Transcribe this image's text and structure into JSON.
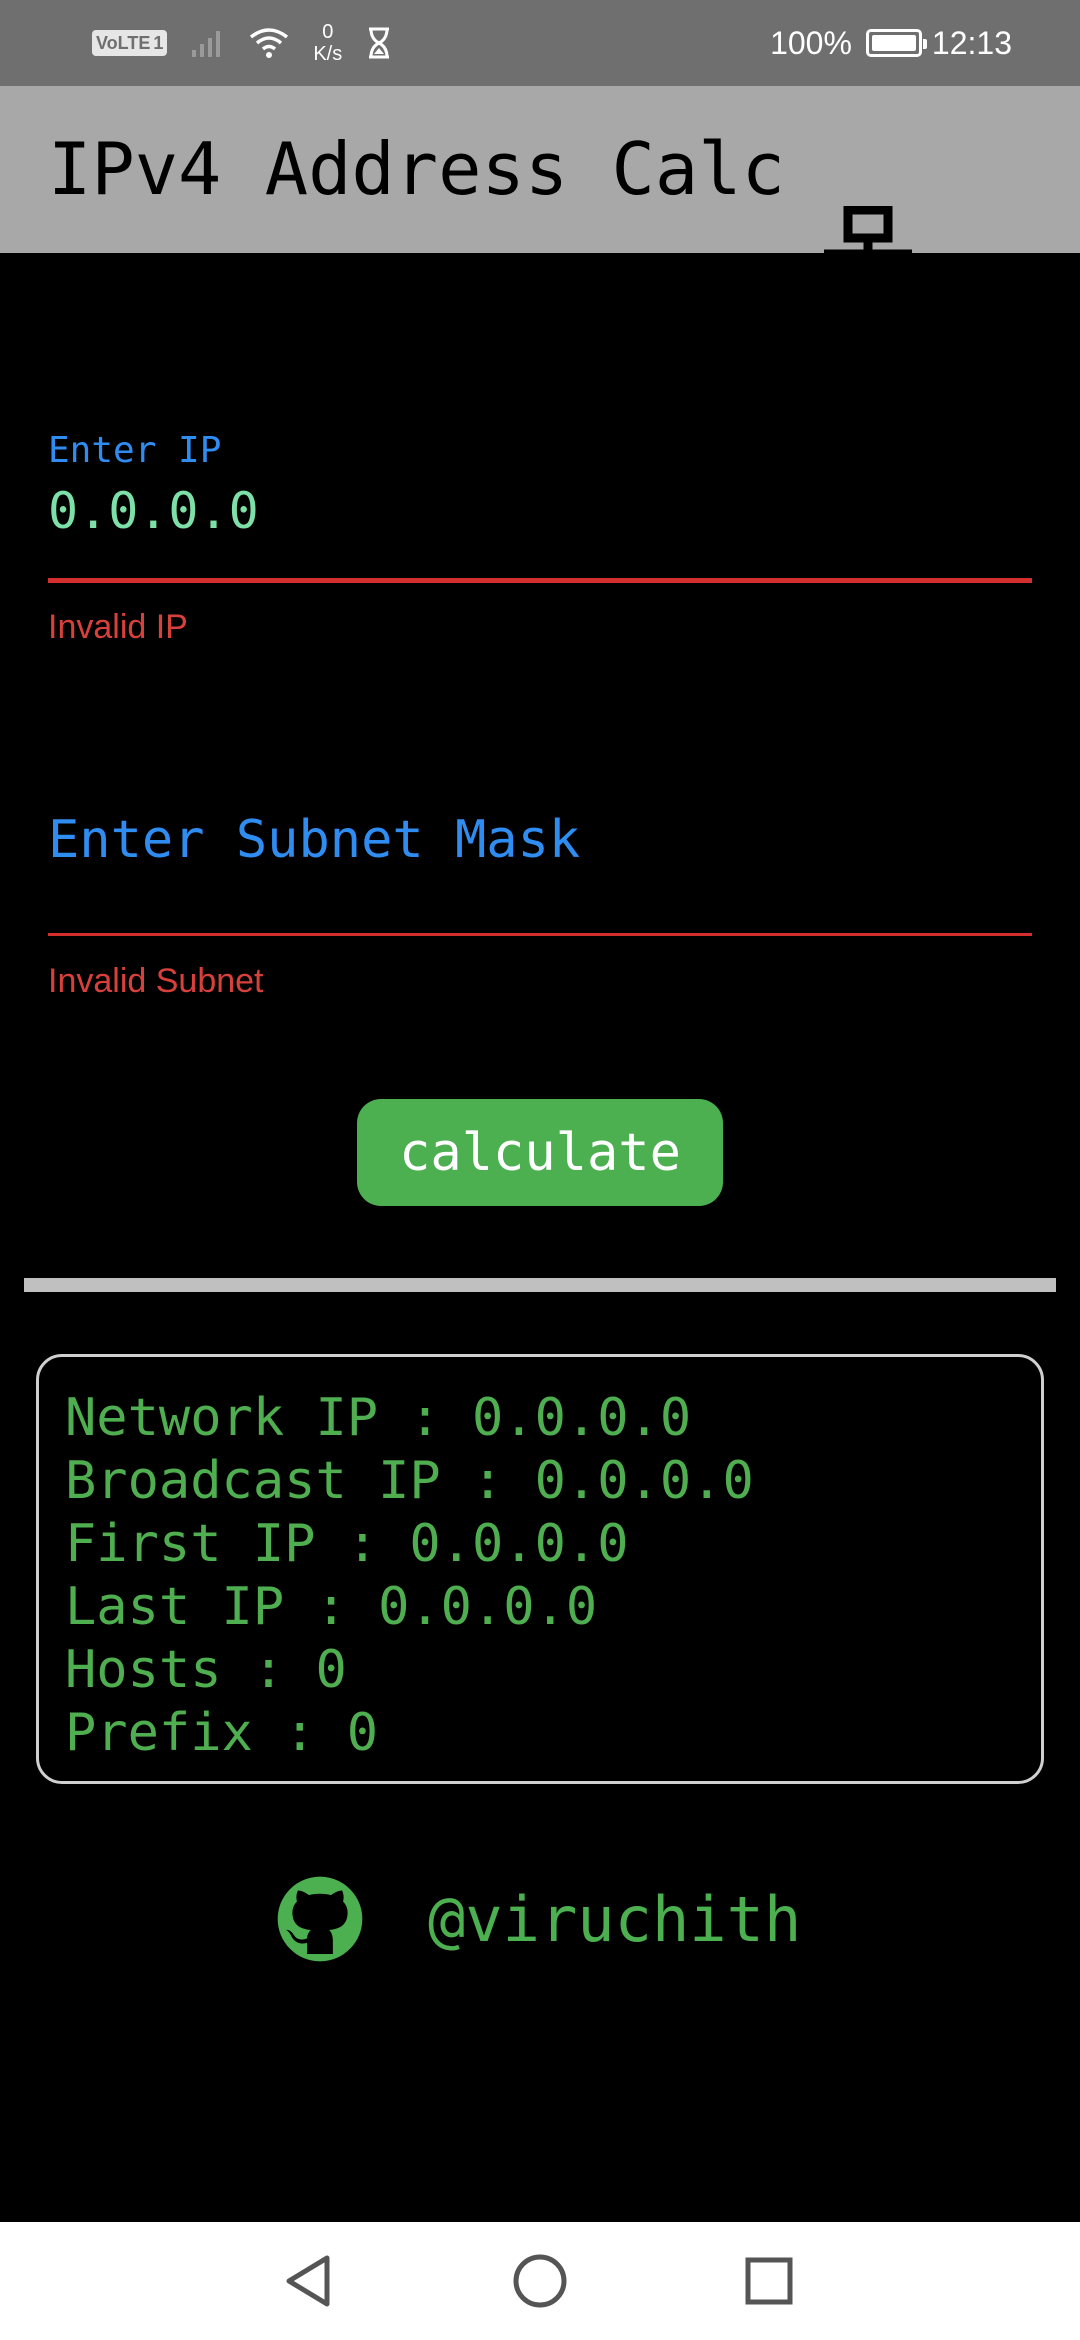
{
  "status_bar": {
    "volte_label": "VoLTE",
    "sim_slot": "1",
    "net_speed_value": "0",
    "net_speed_unit": "K/s",
    "battery_percent": "100%",
    "battery_level": 1.0,
    "time": "12:13"
  },
  "app_bar": {
    "title": "IPv4 Address Calc",
    "icon": "network-icon"
  },
  "ip_field": {
    "label": "Enter IP",
    "value": "0.0.0.0",
    "error": "Invalid IP"
  },
  "subnet_field": {
    "placeholder": "Enter Subnet Mask",
    "error": "Invalid Subnet"
  },
  "calculate_button": {
    "label": "calculate"
  },
  "results": [
    "Network IP : 0.0.0.0",
    "Broadcast IP : 0.0.0.0",
    "First IP : 0.0.0.0",
    "Last IP : 0.0.0.0",
    "Hosts : 0",
    "Prefix : 0"
  ],
  "footer": {
    "icon": "github-icon",
    "handle": "@viruchith"
  },
  "nav_bar": {
    "back_icon": "back-triangle-icon",
    "home_icon": "home-circle-icon",
    "recents_icon": "recents-square-icon"
  },
  "colors": {
    "status_bar_bg": "#6f6f6f",
    "app_bar_bg": "#a8a8a8",
    "background": "#000000",
    "label_blue": "#2f8cf0",
    "value_green": "#7de0a9",
    "error_red": "#d32f2f",
    "button_green": "#4caf50",
    "result_green": "#4fae4f"
  }
}
